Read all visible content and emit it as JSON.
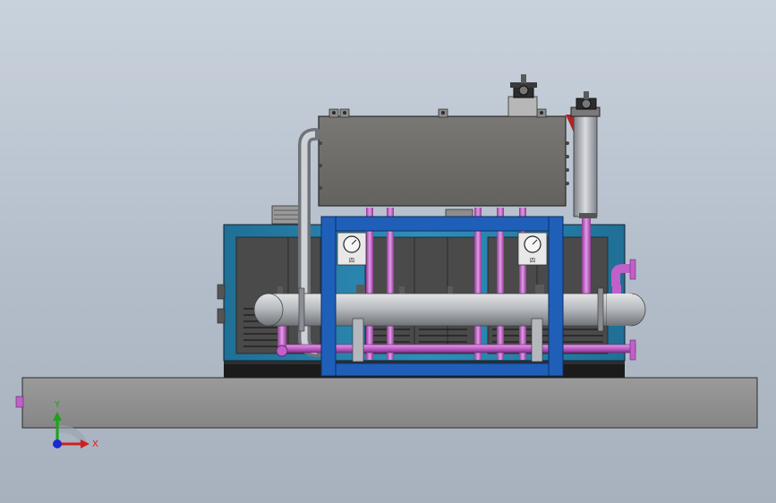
{
  "viewport": {
    "background_top": "#c9d2dc",
    "background_bottom": "#a7b1be"
  },
  "model": {
    "frame_color": "#1f5fb8",
    "housing_color": "#2a7fa8",
    "tank_color": "#6f6d69",
    "pipe_color": "#c060c8",
    "vessel_color": "#b9bcc0",
    "base_color": "#8e8e8e"
  },
  "triad": {
    "y_label": "Y",
    "x_label": "X",
    "y_color": "#1aa31a",
    "x_color": "#d21e1e",
    "z_color": "#1a2ad2"
  },
  "labels": {
    "gauge_left": "四",
    "gauge_right": "四"
  }
}
